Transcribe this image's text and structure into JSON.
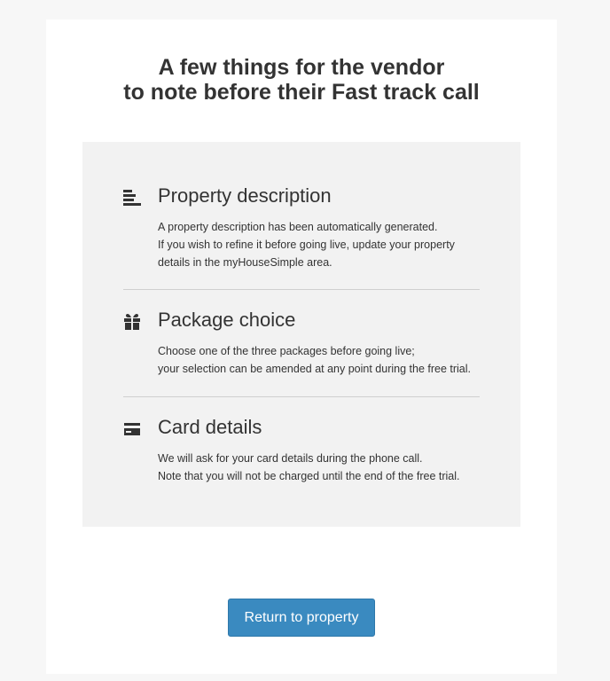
{
  "header": {
    "title_line1": "A few things for the vendor",
    "title_line2": "to note before their Fast track call"
  },
  "sections": [
    {
      "icon": "text-align-left-icon",
      "heading": "Property description",
      "lines": [
        "A property description has been automatically generated.",
        "If you wish to refine it before going live, update your property",
        "details in the myHouseSimple area."
      ]
    },
    {
      "icon": "gift-icon",
      "heading": "Package choice",
      "lines": [
        "Choose one of the three packages before going live;",
        "your selection can be amended at any point during the free trial."
      ]
    },
    {
      "icon": "credit-card-icon",
      "heading": "Card details",
      "lines": [
        "We will ask for your card details during the phone call.",
        "Note that you will not be charged until the end of the free trial."
      ]
    }
  ],
  "actions": {
    "return_label": "Return to property"
  },
  "colors": {
    "page_background": "#f7f7f7",
    "card_background": "#ffffff",
    "panel_background": "#f2f2f2",
    "text": "#333333",
    "button": "#3a8ac0",
    "divider": "#cfcfcf"
  }
}
